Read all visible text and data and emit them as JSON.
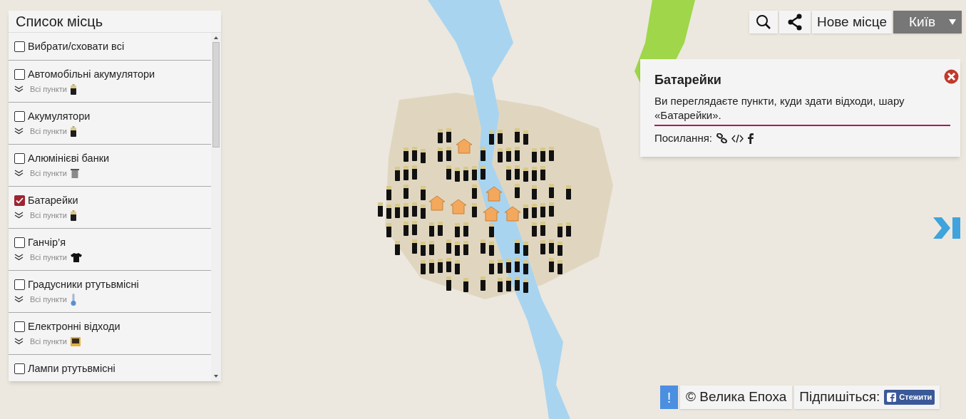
{
  "sidebar": {
    "title": "Список місць",
    "items": [
      {
        "label": "Вибрати/сховати всі",
        "checked": false
      },
      {
        "label": "Автомобільні акумулятори",
        "checked": false,
        "points": "Всі пункти",
        "kind": "battery"
      },
      {
        "label": "Акумулятори",
        "checked": false,
        "points": "Всі пункти",
        "kind": "battery"
      },
      {
        "label": "Алюмінієві банки",
        "checked": false,
        "points": "Всі пункти",
        "kind": "can"
      },
      {
        "label": "Батарейки",
        "checked": true,
        "points": "Всі пункти",
        "kind": "battery"
      },
      {
        "label": "Ганчір’я",
        "checked": false,
        "points": "Всі пункти",
        "kind": "shirt"
      },
      {
        "label": "Градусники ртутьвмісні",
        "checked": false,
        "points": "Всі пункти",
        "kind": "thermometer"
      },
      {
        "label": "Електронні відходи",
        "checked": false,
        "points": "Всі пункти",
        "kind": "monitor"
      },
      {
        "label": "Лампи ртутьвмісні",
        "checked": false
      }
    ]
  },
  "toolbar": {
    "new_place": "Нове місце",
    "city": "Київ"
  },
  "popup": {
    "title": "Батарейки",
    "text": "Ви переглядаєте пункти, куди здати відходи, шару «Батарейки».",
    "links_label": "Посилання:"
  },
  "footer": {
    "alert": "!",
    "copyright": "© Велика Епоха",
    "subscribe": "Підпишіться:",
    "follow": "Стежити"
  }
}
